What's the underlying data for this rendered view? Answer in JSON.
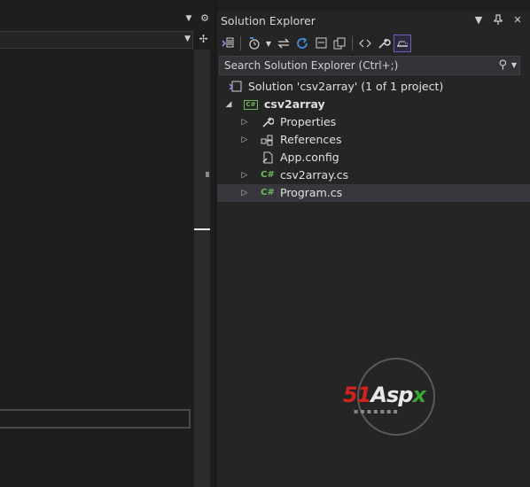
{
  "editor": {
    "dropdown_icon": "chevron-down-icon",
    "settings_icon": "gear-icon",
    "split_icon": "split-view-icon"
  },
  "solution_explorer": {
    "title": "Solution Explorer",
    "title_buttons": [
      "window-position-icon",
      "pin-icon",
      "close-icon"
    ],
    "toolbar": [
      "switch-views-icon",
      "pending-changes-filter-icon",
      "history-icon",
      "sync-icon",
      "refresh-icon",
      "collapse-all-icon",
      "show-all-files-icon",
      "code-view-icon",
      "properties-icon",
      "preview-selected-items-icon"
    ],
    "search": {
      "placeholder": "Search Solution Explorer (Ctrl+;)"
    },
    "tree": {
      "solution": "Solution 'csv2array' (1 of 1 project)",
      "project": "csv2array",
      "items": [
        {
          "label": "Properties",
          "icon": "wrench-icon",
          "expandable": true
        },
        {
          "label": "References",
          "icon": "references-icon",
          "expandable": true
        },
        {
          "label": "App.config",
          "icon": "config-file-icon",
          "expandable": false
        },
        {
          "label": "csv2array.cs",
          "icon": "csharp-file-icon",
          "expandable": true
        },
        {
          "label": "Program.cs",
          "icon": "csharp-file-icon",
          "expandable": true,
          "selected": true
        }
      ]
    }
  },
  "watermark": {
    "logo_part1": "51",
    "logo_part2": "Asp",
    "logo_part3": "x",
    "colors": {
      "red": "#d0231c",
      "green": "#39a535"
    }
  },
  "colors": {
    "background": "#1f1f1f",
    "panel": "#252526",
    "selection": "#37373d",
    "csharp": "#6dbb5e",
    "accent": "#6e5fbe"
  }
}
